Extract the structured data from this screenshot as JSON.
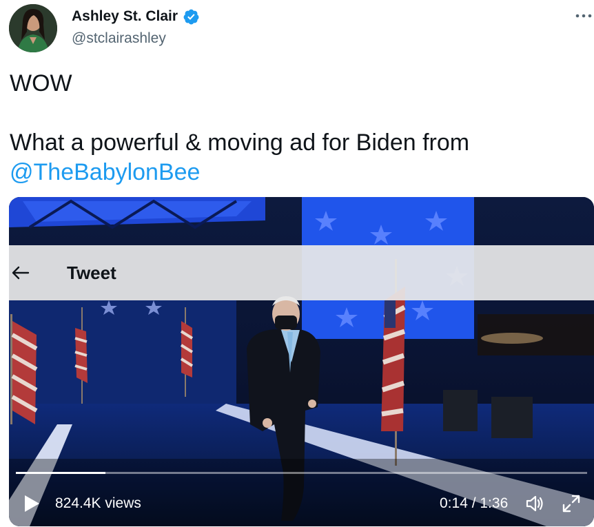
{
  "author": {
    "display_name": "Ashley St. Clair",
    "handle": "@stclairashley",
    "verified": true
  },
  "tweet": {
    "line1": "WOW",
    "line2": "What a powerful & moving ad for Biden from",
    "mention": "@TheBabylonBee"
  },
  "media_overlay": {
    "title": "Tweet",
    "back_icon": "arrow-left-icon"
  },
  "video": {
    "views": "824.4K views",
    "time": "0:14 / 1:36",
    "progress": 0.157,
    "play_icon": "play-icon",
    "volume_icon": "volume-icon",
    "fullscreen_icon": "fullscreen-icon"
  },
  "colors": {
    "accent": "#1d9bf0",
    "text": "#0f1419",
    "muted": "#536471"
  }
}
